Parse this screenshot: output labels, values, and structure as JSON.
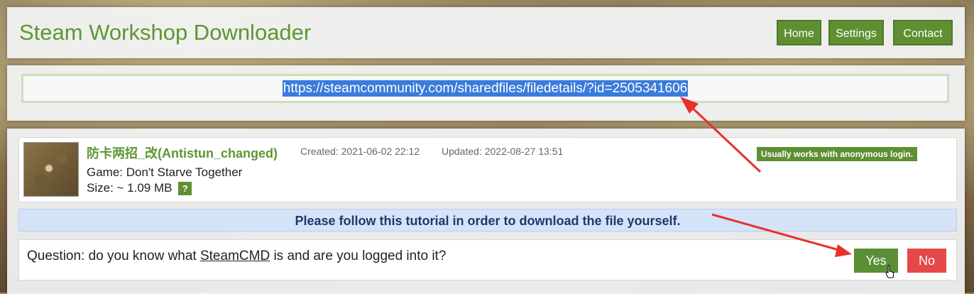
{
  "header": {
    "title": "Steam Workshop Downloader",
    "nav": {
      "home": "Home",
      "settings": "Settings",
      "contact": "Contact"
    }
  },
  "url_input": {
    "value": "https://steamcommunity.com/sharedfiles/filedetails/?id=2505341606",
    "selected": true
  },
  "file": {
    "name": "防卡两招_改(Antistun_changed)",
    "created": "Created: 2021-06-02 22:12",
    "updated": "Updated: 2022-08-27 13:51",
    "anon_badge": "Usually works with anonymous login.",
    "game": "Game: Don't Starve Together",
    "size": "Size: ~ 1.09 MB",
    "size_help": "?"
  },
  "tutorial_banner": "Please follow this tutorial in order to download the file yourself.",
  "question": {
    "prefix": "Question: do you know what ",
    "link": "SteamCMD",
    "suffix": " is and are you logged into it?",
    "yes": "Yes",
    "no": "No"
  },
  "colors": {
    "brand_green": "#5c9732",
    "button_green": "#5f8f32",
    "no_red": "#e54848",
    "banner_blue": "#d5e3f9",
    "annotation_red": "#e8312a"
  },
  "icons": {
    "cursor": "hand-pointer-icon",
    "annotations": "red-arrow-icon"
  }
}
